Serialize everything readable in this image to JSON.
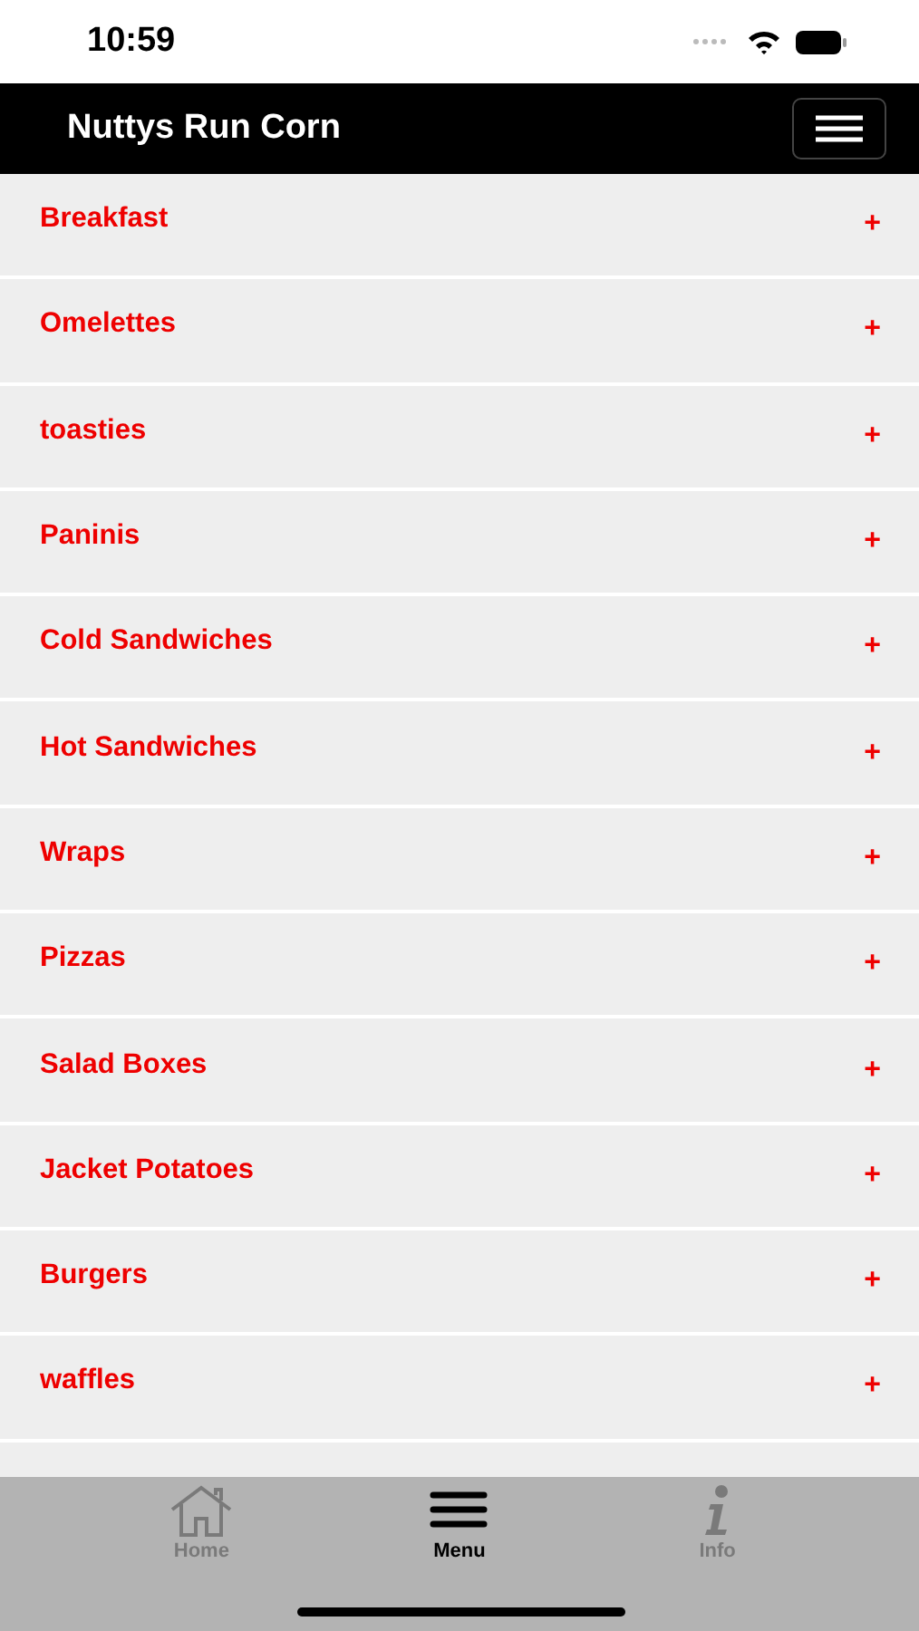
{
  "status_bar": {
    "time": "10:59"
  },
  "header": {
    "title": "Nuttys Run Corn"
  },
  "menu_categories": [
    {
      "label": "Breakfast",
      "expander": "+"
    },
    {
      "label": "Omelettes",
      "expander": "+"
    },
    {
      "label": "toasties",
      "expander": "+"
    },
    {
      "label": "Paninis",
      "expander": "+"
    },
    {
      "label": "Cold Sandwiches",
      "expander": "+"
    },
    {
      "label": "Hot Sandwiches",
      "expander": "+"
    },
    {
      "label": "Wraps",
      "expander": "+"
    },
    {
      "label": "Pizzas",
      "expander": "+"
    },
    {
      "label": "Salad Boxes",
      "expander": "+"
    },
    {
      "label": "Jacket Potatoes",
      "expander": "+"
    },
    {
      "label": "Burgers",
      "expander": "+"
    },
    {
      "label": "waffles",
      "expander": "+"
    }
  ],
  "tab_bar": [
    {
      "label": "Home",
      "kind": "home",
      "selected": false
    },
    {
      "label": "Menu",
      "kind": "menu",
      "selected": true
    },
    {
      "label": "Info",
      "kind": "info",
      "selected": false
    }
  ]
}
